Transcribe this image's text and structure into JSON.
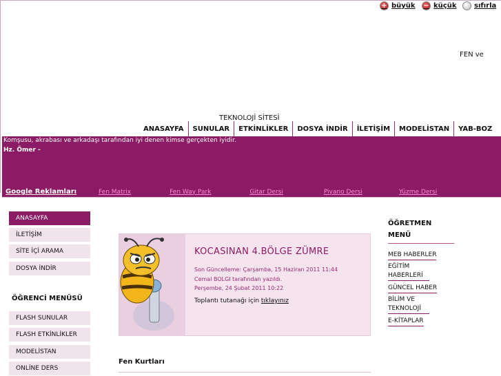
{
  "font_controls": {
    "bigger": "büyük",
    "smaller": "küçük",
    "reset": "sıfırla"
  },
  "header": {
    "fen_ve": "FEN ve",
    "tech_site": "TEKNOLOJİ SİTESİ"
  },
  "nav": [
    "ANASAYFA",
    "SUNULAR",
    "ETKİNLİKLER",
    "DOSYA İNDİR",
    "İLETİŞİM",
    "MODELİSTAN",
    "YAB-BOZ"
  ],
  "banner": {
    "quote": "Komşusu, akrabası ve arkadaşı tarafından iyi denen kimse gerçekten iyidir.",
    "author": "Hz. Ömer -"
  },
  "ads": {
    "title": "Google Reklamları",
    "links": [
      "Fen Matrix",
      "Fen Way Park",
      "Gitar Dersi",
      "Piyano Dersi",
      "Yüzme Dersi"
    ]
  },
  "left_menu": [
    "ANASAYFA",
    "İLETİŞİM",
    "SİTE İÇİ ARAMA",
    "DOSYA İNDİR"
  ],
  "student_menu": {
    "title": "ÖĞRENCİ MENÜSÜ",
    "items": [
      "FLASH SUNULAR",
      "FLASH ETKİNLİKLER",
      "MODELİSTAN",
      "ONLİNE DERS"
    ]
  },
  "news": {
    "title": "KOCASINAN 4.BÖLGE ZÜMRE",
    "updated": "Son Güncelleme: Çarşamba, 15 Haziran 2011 11:44",
    "author": "Cemal BOLGI tarafından yazıldı.",
    "date": "Perşembe, 24 Şubat 2011 10:22",
    "body_text": "Toplantı tutanağı için",
    "body_link": "tıklayınız"
  },
  "fen_section_title": "Fen Kurtları",
  "teacher_menu": {
    "title": "ÖĞRETMEN MENÜ",
    "items": [
      "MEB HABERLER",
      "EĞİTİM HABERLERİ",
      "GÜNCEL HABER",
      "BİLİM VE TEKNOLOJİ",
      "E-KİTAPLAR"
    ]
  },
  "colors": {
    "brand": "#8a1b64",
    "menu_bg": "#f1e3ec",
    "ad_link": "#ff8ad8"
  }
}
